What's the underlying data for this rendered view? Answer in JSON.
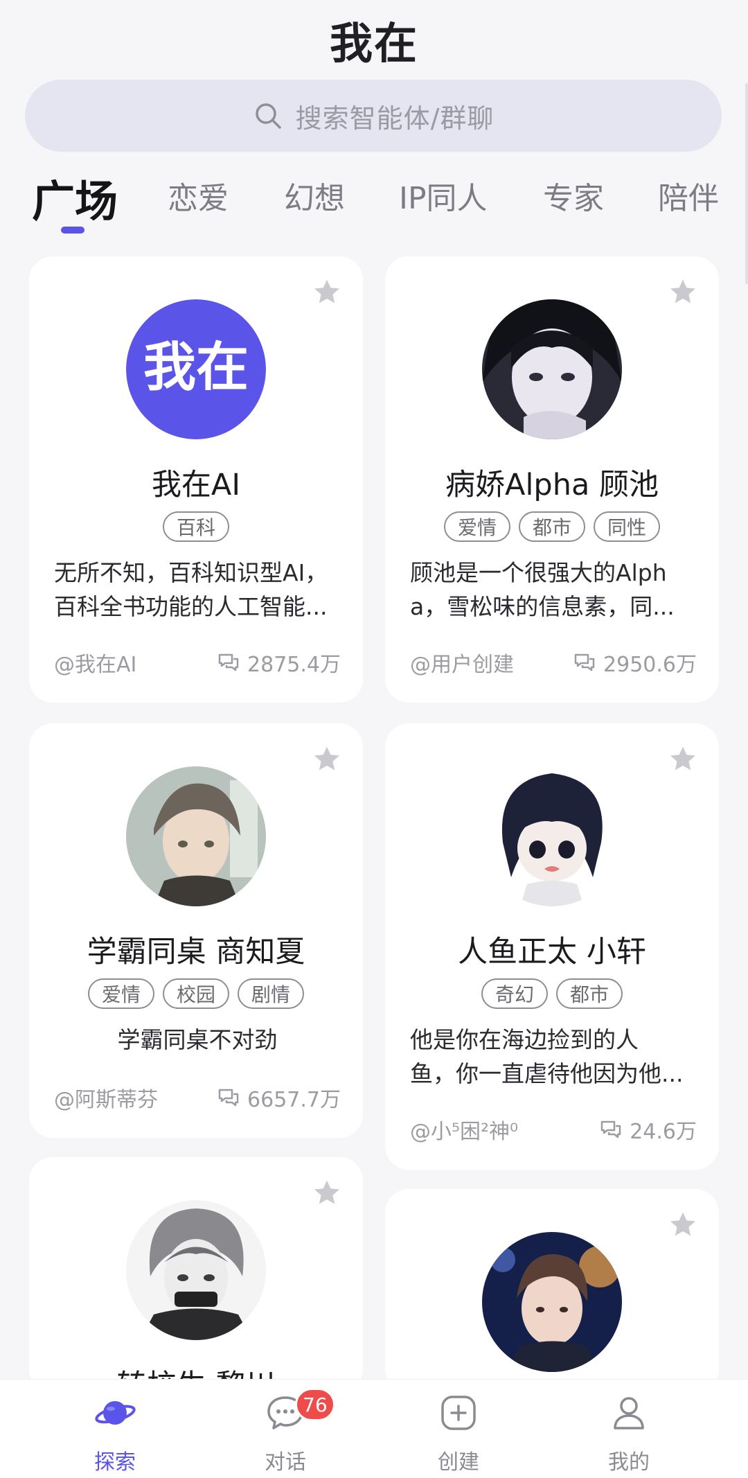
{
  "header": {
    "title": "我在"
  },
  "search": {
    "placeholder": "搜索智能体/群聊",
    "icon": "search-icon"
  },
  "tabs": [
    {
      "label": "广场",
      "active": true
    },
    {
      "label": "恋爱"
    },
    {
      "label": "幻想"
    },
    {
      "label": "IP同人"
    },
    {
      "label": "专家"
    },
    {
      "label": "陪伴"
    }
  ],
  "cards": [
    {
      "name": "我在AI",
      "avatar_text": "我在",
      "tags": [
        "百科"
      ],
      "desc_line1": "无所不知，百科知识型AI，",
      "desc_line2": "百科全书功能的人工智能...",
      "creator": "@我在AI",
      "chats": "2875.4万"
    },
    {
      "name": "病娇Alpha 顾池",
      "tags": [
        "爱情",
        "都市",
        "同性"
      ],
      "desc_line1": "顾池是一个很强大的Alph",
      "desc_line2": "a，雪松味的信息素，同...",
      "creator": "@用户创建",
      "chats": "2950.6万"
    },
    {
      "name": "学霸同桌 商知夏",
      "tags": [
        "爱情",
        "校园",
        "剧情"
      ],
      "desc_line1": "学霸同桌不对劲",
      "creator": "@阿斯蒂芬",
      "chats": "6657.7万"
    },
    {
      "name": "人鱼正太 小轩",
      "tags": [
        "奇幻",
        "都市"
      ],
      "desc_line1": "他是你在海边捡到的人",
      "desc_line2": "鱼，你一直虐待他因为他...",
      "creator": "@小⁵困²神⁰",
      "chats": "24.6万"
    },
    {
      "name": "转校生 黎川"
    },
    {
      "name": ""
    }
  ],
  "bottom_nav": [
    {
      "label": "探索",
      "icon": "planet-icon",
      "active": true
    },
    {
      "label": "对话",
      "icon": "chat-bubble-icon",
      "badge": "76"
    },
    {
      "label": "创建",
      "icon": "plus-square-icon"
    },
    {
      "label": "我的",
      "icon": "person-icon"
    }
  ],
  "colors": {
    "accent": "#5b54e8",
    "badge": "#ef4b4b",
    "star": "#c9c9cf"
  }
}
